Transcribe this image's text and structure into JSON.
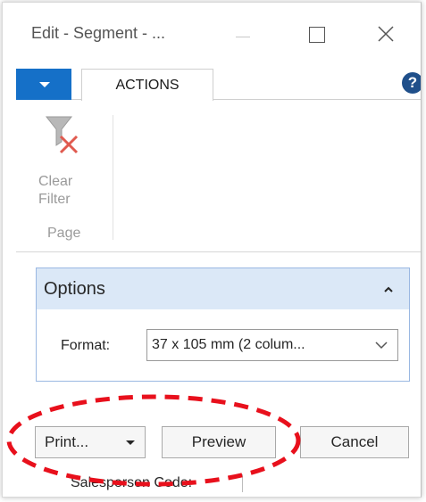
{
  "window": {
    "title": "Edit - Segment - ..."
  },
  "ribbon": {
    "dropdown_icon": "caret-down-icon",
    "tab_actions_label": "ACTIONS",
    "help_icon": "question-mark-icon",
    "clear_filter_label": "Clear\nFilter",
    "clear_filter_line1": "Clear",
    "clear_filter_line2": "Filter",
    "group_label": "Page"
  },
  "options": {
    "title": "Options",
    "format_label": "Format:",
    "format_value": "37 x 105 mm (2 colum..."
  },
  "buttons": {
    "print_label": "Print...",
    "preview_label": "Preview",
    "cancel_label": "Cancel"
  },
  "partial": {
    "field_label": "Salesperson Code:"
  },
  "colors": {
    "ribbon_tab_accent": "#1570c8",
    "options_header_bg": "#dbe8f7",
    "options_border": "#9ab8e2",
    "highlight_annotation": "#e8101c",
    "clear_filter_x": "#e05a4f"
  }
}
